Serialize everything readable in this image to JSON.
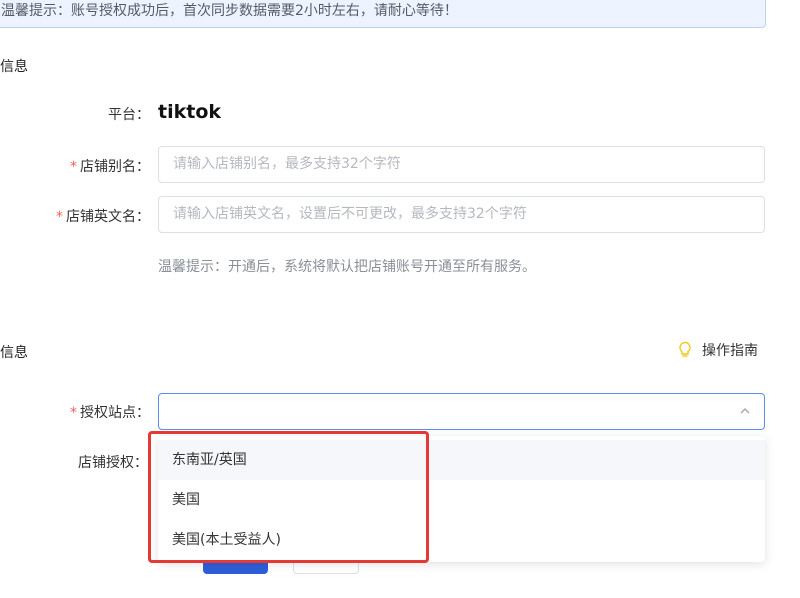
{
  "notice": {
    "text": "温馨提示：账号授权成功后，首次同步数据需要2小时左右，请耐心等待！"
  },
  "section_basic": {
    "title": "信息"
  },
  "platform": {
    "label": "平台：",
    "value": "tiktok"
  },
  "store_alias": {
    "required_mark": "*",
    "label": "店铺别名：",
    "placeholder": "请输入店铺别名，最多支持32个字符"
  },
  "store_english_name": {
    "required_mark": "*",
    "label": "店铺英文名：",
    "placeholder": "请输入店铺英文名，设置后不可更改，最多支持32个字符"
  },
  "open_hint": {
    "text": "温馨提示：开通后，系统将默认把店铺账号开通至所有服务。"
  },
  "section_auth": {
    "title": "信息"
  },
  "guide": {
    "label": "操作指南",
    "icon": "lightbulb-icon",
    "icon_color": "#f5c518"
  },
  "auth_site": {
    "required_mark": "*",
    "label": "授权站点：",
    "value": "",
    "options": [
      {
        "label": "东南亚/英国"
      },
      {
        "label": "美国"
      },
      {
        "label": "美国(本土受益人)"
      }
    ]
  },
  "store_auth": {
    "label": "店铺授权："
  },
  "colors": {
    "accent": "#2e5ed8",
    "required": "#f25f5c",
    "highlight": "#e53935",
    "notice_bg": "#eef4ff"
  }
}
